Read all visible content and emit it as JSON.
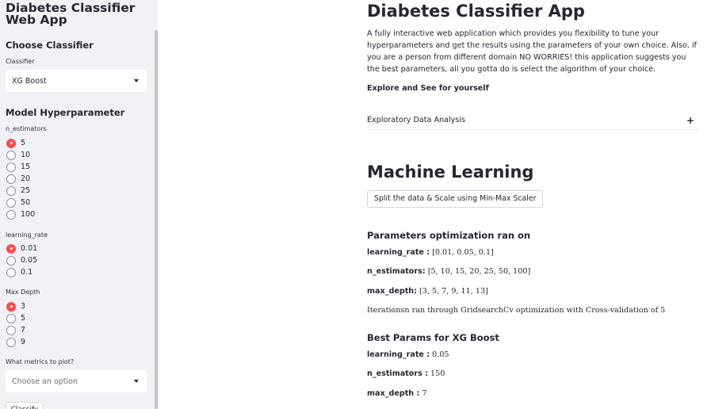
{
  "sidebar": {
    "app_title": "Diabetes Classifier Web App",
    "choose_classifier_title": "Choose Classifier",
    "classifier_label": "Classifier",
    "classifier_value": "XG Boost",
    "hyperparam_title": "Model Hyperparameter",
    "n_estimators": {
      "label": "n_estimators",
      "options": [
        "5",
        "10",
        "15",
        "20",
        "25",
        "50",
        "100"
      ],
      "selected": "5"
    },
    "learning_rate": {
      "label": "learning_rate",
      "options": [
        "0.01",
        "0.05",
        "0.1"
      ],
      "selected": "0.01"
    },
    "max_depth": {
      "label": "Max Depth",
      "options": [
        "3",
        "5",
        "7",
        "9"
      ],
      "selected": "3"
    },
    "metrics_label": "What metrics to plot?",
    "metrics_placeholder": "Choose an option",
    "classify_label": "Classify"
  },
  "main": {
    "title": "Diabetes Classifier App",
    "description": "A fully interactive web application which provides you flexibility to tune your hyperparameters and get the results using the parameters of your own choice. Also, if you are a person from different domain NO WORRIES! this application suggests you the best parameters, all you gotta do is select the algorithm of your choice.",
    "explore": "Explore and See for yourself",
    "expander_label": "Exploratory Data Analysis",
    "expander_icon": "+",
    "ml_title": "Machine Learning",
    "split_button": "Split the data & Scale using Min-Max Scaler",
    "params_opt_title": "Parameters optimization ran on",
    "opt_params": [
      {
        "key": "learning_rate :",
        "value": " [0.01, 0.05, 0.1]"
      },
      {
        "key": "n_estimators:",
        "value": " [5, 10, 15, 20, 25, 50, 100]"
      },
      {
        "key": "max_depth:",
        "value": " [3, 5, 7, 9, 11, 13]"
      }
    ],
    "note": "Iterationsn ran through GridsearchCv optimization with Cross-validation of 5",
    "best_title": "Best Params for XG Boost",
    "best_params": [
      {
        "key": "learning_rate :",
        "value": " 0.05"
      },
      {
        "key": "n_estimators :",
        "value": " 150"
      },
      {
        "key": "max_depth :",
        "value": " 7"
      }
    ]
  },
  "colors": {
    "accent": "#ff4b4b",
    "sidebar_bg": "#f0f2f6",
    "text": "#262730"
  }
}
